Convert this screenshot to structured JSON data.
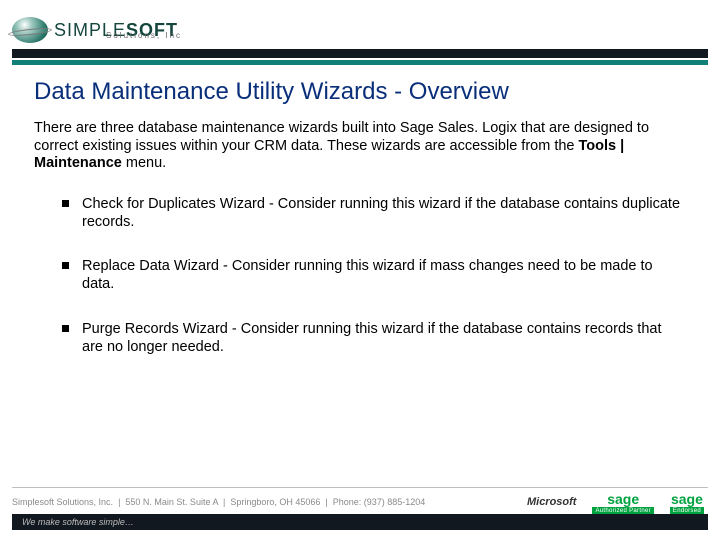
{
  "brand": {
    "name_part1": "SIMPLE",
    "name_part2": "SOFT",
    "sub": "Solutions, Inc"
  },
  "title": "Data Maintenance Utility Wizards - Overview",
  "intro_pre": "There are three database maintenance wizards built into Sage Sales. Logix that are designed to correct existing issues within your CRM data. These wizards are accessible from the ",
  "intro_bold": "Tools | Maintenance",
  "intro_post": " menu.",
  "bullets": [
    "Check for Duplicates Wizard - Consider running this wizard if the database contains duplicate records.",
    "Replace Data Wizard - Consider running this wizard if mass changes need to be made to data.",
    "Purge Records Wizard - Consider running this wizard if the database contains records that are no longer needed."
  ],
  "footer": {
    "company": "Simplesoft Solutions, Inc.",
    "address": "550 N. Main St. Suite A",
    "city": "Springboro, OH 45066",
    "phone_label": "Phone:",
    "phone": "(937) 885-1204"
  },
  "partners": {
    "microsoft": "Microsoft",
    "sage": "sage",
    "sage_sub1": "Authorized Partner",
    "sage_sub2": "Endorsed"
  },
  "tagline": "We make software simple…"
}
